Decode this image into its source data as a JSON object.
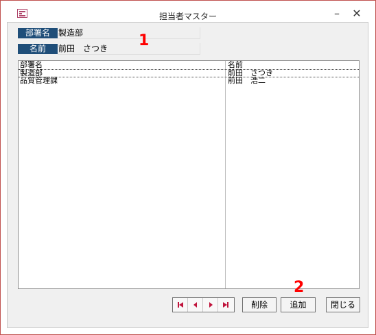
{
  "window": {
    "title": "担当者マスター",
    "minimize_label": "–",
    "close_label": "✕",
    "app_icon": "form-icon"
  },
  "form": {
    "dept_label": "部署名",
    "dept_value": "製造部",
    "name_label": "名前",
    "name_value": "前田　さつき"
  },
  "list": {
    "headers": [
      "部署名",
      "名前"
    ],
    "rows": [
      [
        "製造部",
        "前田　さつき"
      ],
      [
        "品質管理課",
        "前田　浩二"
      ]
    ]
  },
  "annotations": {
    "one": "1",
    "two": "2"
  },
  "navigation": [
    "first-record-icon",
    "prev-record-icon",
    "next-record-icon",
    "last-record-icon"
  ],
  "buttons": {
    "delete": "削除",
    "add": "追加",
    "close": "閉じる"
  },
  "colors": {
    "label_bg": "#1f4e79",
    "annotation": "#ff0000",
    "nav_accent": "#c0143c"
  }
}
